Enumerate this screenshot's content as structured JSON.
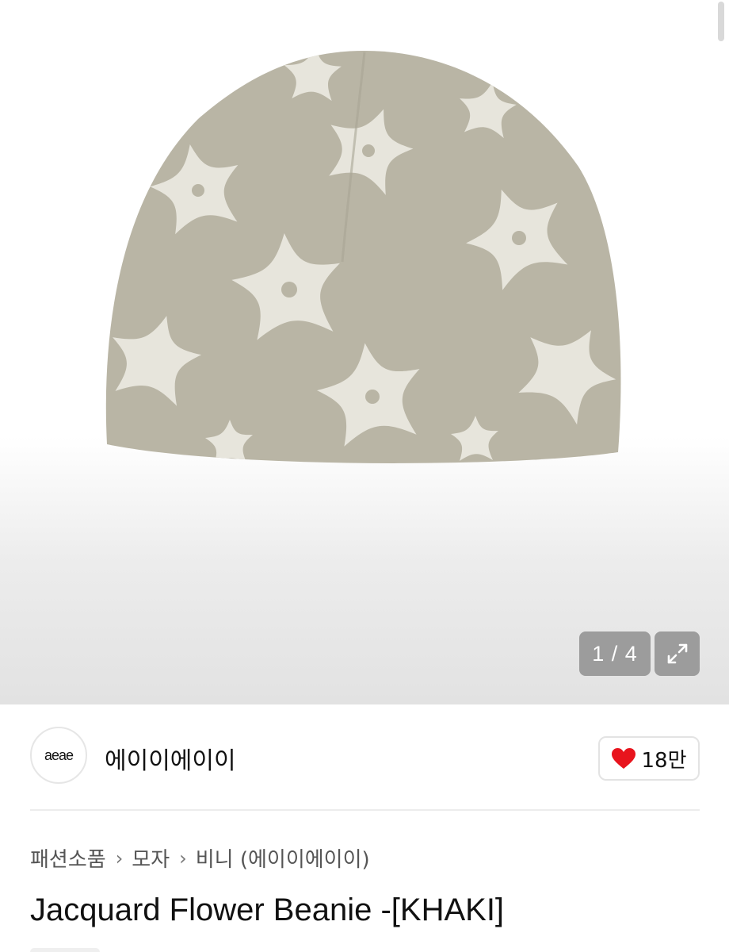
{
  "gallery": {
    "counter": "1 / 4",
    "expand_icon": "expand-icon",
    "image_label": "Jacquard Flower Beanie khaki product photo"
  },
  "seller": {
    "avatar_text": "aeae",
    "name": "에이이에이이",
    "like_count": "18만",
    "heart_color": "#e8141d"
  },
  "breadcrumb": {
    "items": [
      "패션소품",
      "모자",
      "비니 (에이이에이이)"
    ]
  },
  "product": {
    "title": "Jacquard Flower Beanie -[KHAKI]"
  },
  "colors": {
    "beanie": "#b9b5a5",
    "flower": "#e7e5dc",
    "badge_bg": "#9c9c9c"
  }
}
